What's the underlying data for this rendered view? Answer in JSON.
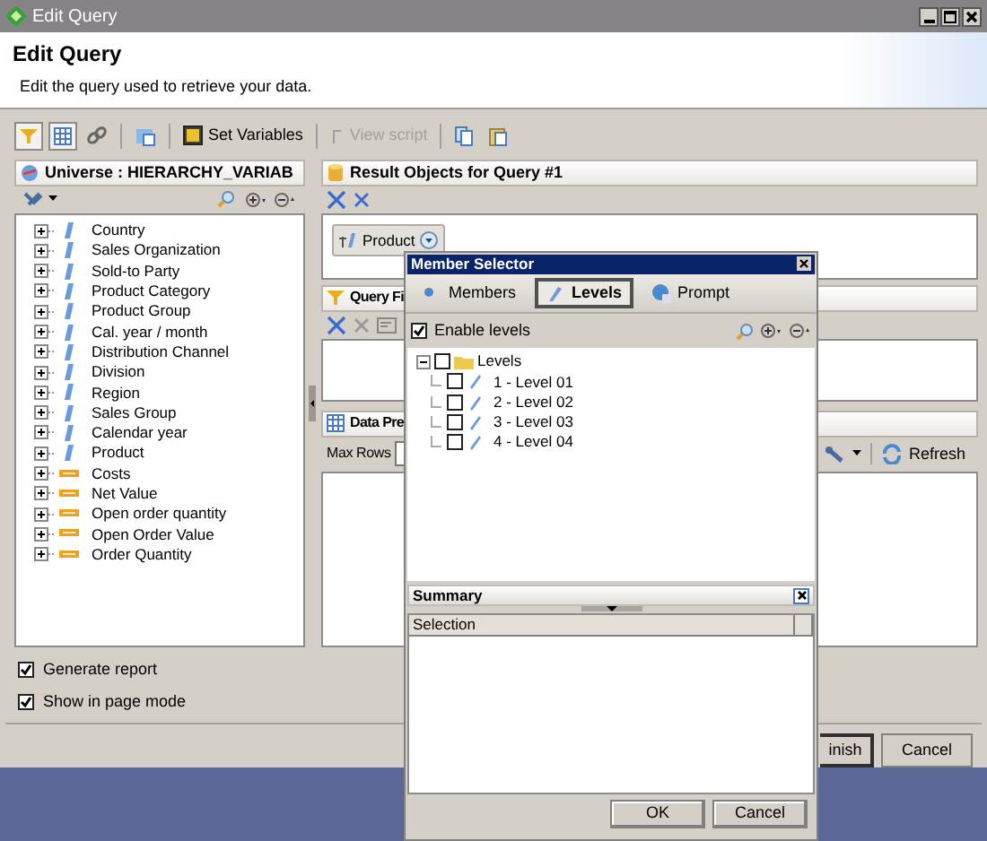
{
  "window": {
    "title": "Edit Query"
  },
  "header": {
    "title": "Edit Query",
    "subtitle": "Edit the query used to retrieve your data."
  },
  "toolbar": [
    {
      "kind": "filter",
      "pressed": true
    },
    {
      "kind": "grid",
      "pressed": true
    },
    {
      "kind": "link",
      "pressed": false
    },
    {
      "kind": "separator"
    },
    {
      "kind": "props",
      "pressed": false
    },
    {
      "kind": "separator"
    },
    {
      "kind": "button",
      "label": "Set Variables",
      "disabled": false
    },
    {
      "kind": "separator"
    },
    {
      "kind": "button",
      "label": "View script",
      "disabled": true
    },
    {
      "kind": "separator"
    },
    {
      "kind": "copy",
      "pressed": false
    },
    {
      "kind": "paste",
      "pressed": false
    }
  ],
  "universe_panel": {
    "title": "Universe : HIERARCHY_VARIAB",
    "items": [
      {
        "label": "Country",
        "kind": "dimension"
      },
      {
        "label": "Sales Organization",
        "kind": "dimension"
      },
      {
        "label": "Sold-to Party",
        "kind": "dimension"
      },
      {
        "label": "Product Category",
        "kind": "dimension"
      },
      {
        "label": "Product Group",
        "kind": "dimension"
      },
      {
        "label": "Cal. year / month",
        "kind": "dimension"
      },
      {
        "label": "Distribution Channel",
        "kind": "dimension"
      },
      {
        "label": "Division",
        "kind": "dimension"
      },
      {
        "label": "Region",
        "kind": "dimension"
      },
      {
        "label": "Sales Group",
        "kind": "dimension"
      },
      {
        "label": "Calendar year",
        "kind": "dimension"
      },
      {
        "label": "Product",
        "kind": "dimension"
      },
      {
        "label": "Costs",
        "kind": "measure"
      },
      {
        "label": "Net Value",
        "kind": "measure"
      },
      {
        "label": "Open order quantity",
        "kind": "measure"
      },
      {
        "label": "Open Order Value",
        "kind": "measure"
      },
      {
        "label": "Order Quantity",
        "kind": "measure"
      }
    ]
  },
  "result_objects_panel": {
    "title": "Result Objects for Query #1",
    "objects": [
      "Product"
    ]
  },
  "query_filters_panel": {
    "title": "Query Fi"
  },
  "data_preview_panel": {
    "title": "Data Pre",
    "max_rows_label": "Max Rows",
    "refresh_button": "Refresh"
  },
  "options": [
    {
      "label": "Generate report",
      "checked": true
    },
    {
      "label": "Show in page mode",
      "checked": true
    }
  ],
  "buttons": [
    "inish",
    "Cancel"
  ],
  "member_selector": {
    "title": "Member Selector",
    "tabs": [
      {
        "label": "Members",
        "selected": false
      },
      {
        "label": "Levels",
        "selected": true
      },
      {
        "label": "Prompt",
        "selected": false
      }
    ],
    "enable_levels": {
      "label": "Enable levels",
      "checked": true
    },
    "tree": {
      "label": "Levels",
      "checked": false,
      "expanded": true,
      "children": [
        {
          "label": "1 - Level 01",
          "checked": false
        },
        {
          "label": "2 - Level 02",
          "checked": false
        },
        {
          "label": "3 - Level 03",
          "checked": false
        },
        {
          "label": "4 - Level 04",
          "checked": false
        }
      ]
    },
    "summary": {
      "title": "Summary",
      "columns": [
        "Selection"
      ]
    },
    "buttons": [
      "OK",
      "Cancel"
    ]
  }
}
